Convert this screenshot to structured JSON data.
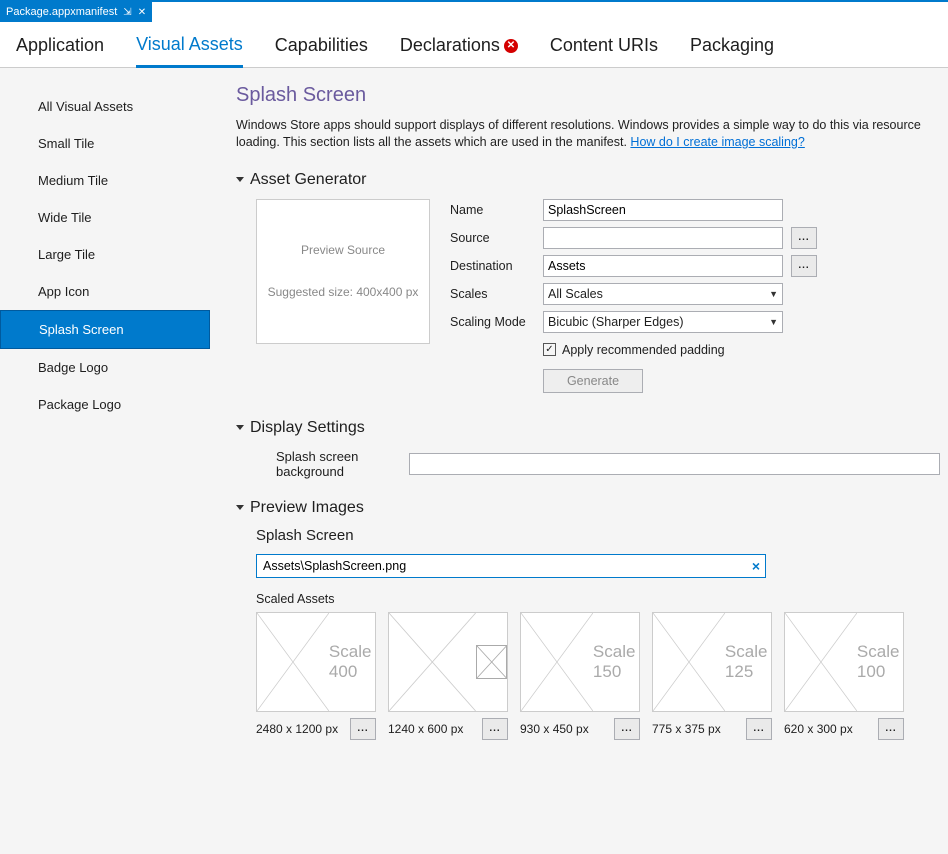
{
  "documentTab": {
    "title": "Package.appxmanifest",
    "pinGlyph": "⇲",
    "closeGlyph": "✕"
  },
  "topTabs": [
    {
      "label": "Application",
      "active": false,
      "hasError": false
    },
    {
      "label": "Visual Assets",
      "active": true,
      "hasError": false
    },
    {
      "label": "Capabilities",
      "active": false,
      "hasError": false
    },
    {
      "label": "Declarations",
      "active": false,
      "hasError": true
    },
    {
      "label": "Content URIs",
      "active": false,
      "hasError": false
    },
    {
      "label": "Packaging",
      "active": false,
      "hasError": false
    }
  ],
  "sidebar": {
    "items": [
      "All Visual Assets",
      "Small Tile",
      "Medium Tile",
      "Wide Tile",
      "Large Tile",
      "App Icon",
      "Splash Screen",
      "Badge Logo",
      "Package Logo"
    ],
    "selectedIndex": 6
  },
  "pageTitle": "Splash Screen",
  "description": {
    "text": "Windows Store apps should support displays of different resolutions. Windows provides a simple way to do this via resource loading. This section lists all the assets which are used in the manifest. ",
    "linkText": "How do I create image scaling?"
  },
  "assetGenerator": {
    "header": "Asset Generator",
    "preview": {
      "line1": "Preview Source",
      "line2": "Suggested size: 400x400 px"
    },
    "fields": {
      "nameLabel": "Name",
      "nameValue": "SplashScreen",
      "sourceLabel": "Source",
      "sourceValue": "",
      "destLabel": "Destination",
      "destValue": "Assets",
      "scalesLabel": "Scales",
      "scalesValue": "All Scales",
      "modeLabel": "Scaling Mode",
      "modeValue": "Bicubic (Sharper Edges)",
      "paddingLabel": "Apply recommended padding",
      "paddingChecked": true,
      "generateLabel": "Generate",
      "browse": "..."
    }
  },
  "displaySettings": {
    "header": "Display Settings",
    "bgLabel": "Splash screen background",
    "bgValue": ""
  },
  "previewImages": {
    "header": "Preview Images",
    "subHeader": "Splash Screen",
    "pathValue": "Assets\\SplashScreen.png",
    "scaledLabel": "Scaled Assets",
    "browse": "...",
    "scales": [
      {
        "label": "Scale 400",
        "dim": "2480 x 1200 px",
        "hasPreview": false
      },
      {
        "label": "",
        "dim": "1240 x 600 px",
        "hasPreview": true
      },
      {
        "label": "Scale 150",
        "dim": "930 x 450 px",
        "hasPreview": false
      },
      {
        "label": "Scale 125",
        "dim": "775 x 375 px",
        "hasPreview": false
      },
      {
        "label": "Scale 100",
        "dim": "620 x 300 px",
        "hasPreview": false
      }
    ]
  }
}
